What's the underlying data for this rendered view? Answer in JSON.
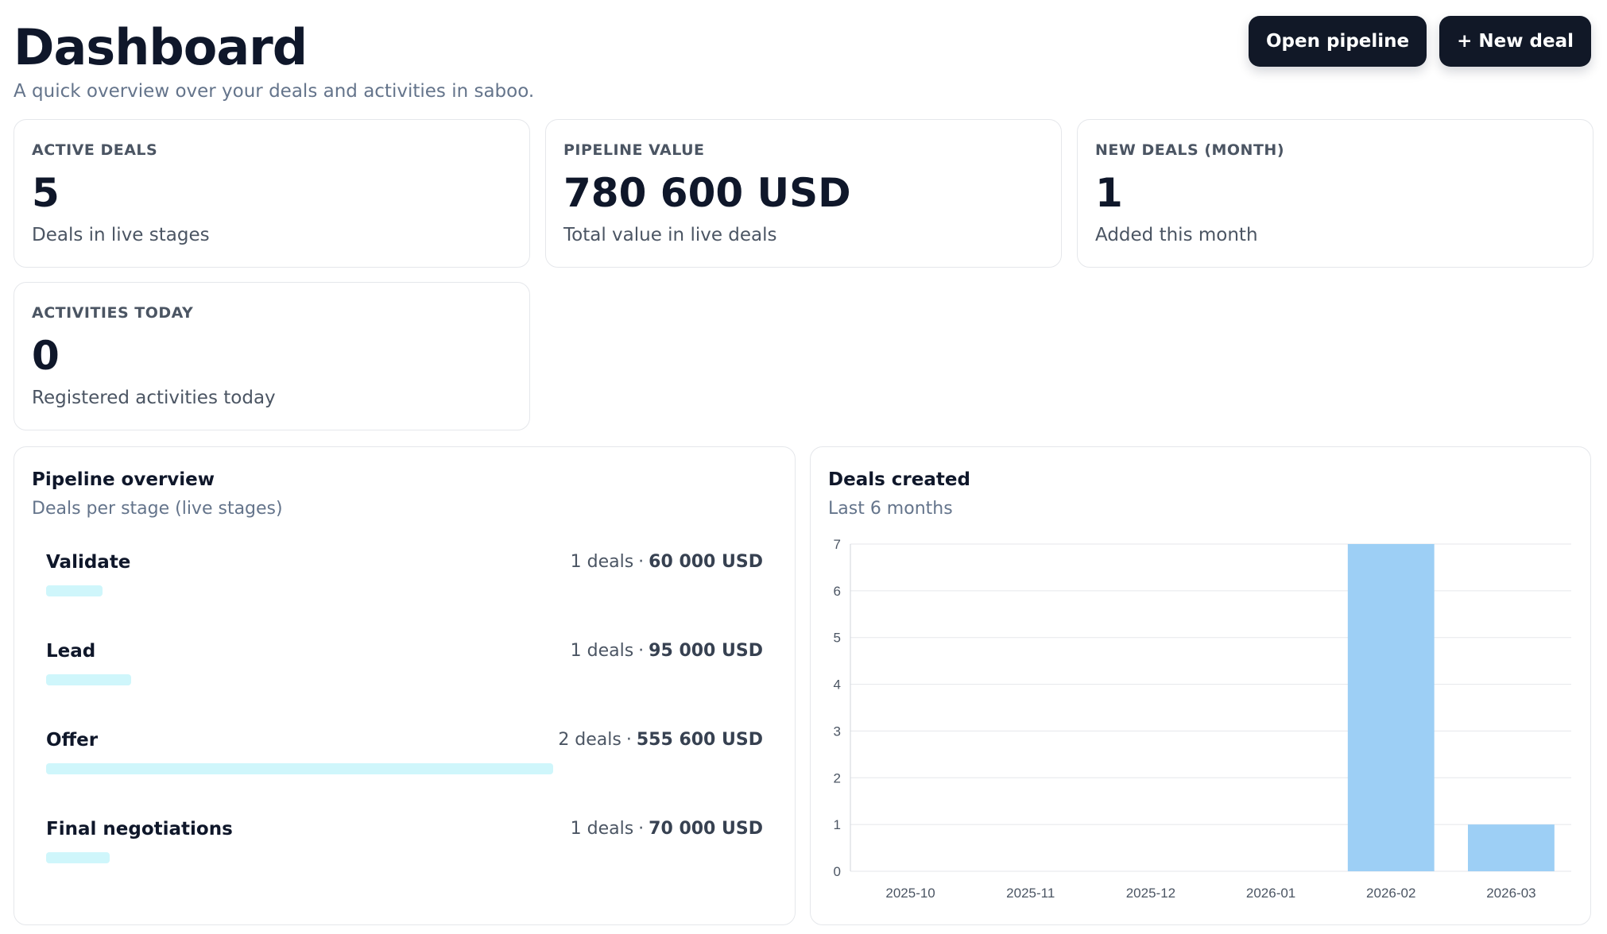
{
  "header": {
    "title": "Dashboard",
    "subtitle": "A quick overview over your deals and activities in saboo.",
    "open_pipeline_label": "Open pipeline",
    "new_deal_label": "+ New deal"
  },
  "kpis": [
    {
      "label": "ACTIVE DEALS",
      "value": "5",
      "sub": "Deals in live stages"
    },
    {
      "label": "PIPELINE VALUE",
      "value": "780 600 USD",
      "sub": "Total value in live deals"
    },
    {
      "label": "NEW DEALS (MONTH)",
      "value": "1",
      "sub": "Added this month"
    },
    {
      "label": "ACTIVITIES TODAY",
      "value": "0",
      "sub": "Registered activities today"
    }
  ],
  "pipeline": {
    "title": "Pipeline overview",
    "subtitle": "Deals per stage (live stages)",
    "stages": [
      {
        "name": "Validate",
        "deals": "1 deals",
        "separator": "·",
        "amount": "60 000 USD",
        "share": 0.112
      },
      {
        "name": "Lead",
        "deals": "1 deals",
        "separator": "·",
        "amount": "95 000 USD",
        "share": 0.168
      },
      {
        "name": "Offer",
        "deals": "2 deals",
        "separator": "·",
        "amount": "555 600 USD",
        "share": 1.0
      },
      {
        "name": "Final negotiations",
        "deals": "1 deals",
        "separator": "·",
        "amount": "70 000 USD",
        "share": 0.126
      }
    ]
  },
  "deals_chart": {
    "title": "Deals created",
    "subtitle": "Last 6 months"
  },
  "colors": {
    "bar_fill": "#9dcff5",
    "pipeline_bar": "#cff6fb",
    "button_bg": "#111827"
  },
  "chart_data": {
    "type": "bar",
    "categories": [
      "2025-10",
      "2025-11",
      "2025-12",
      "2026-01",
      "2026-02",
      "2026-03"
    ],
    "values": [
      0,
      0,
      0,
      0,
      7,
      1
    ],
    "title": "Deals created",
    "subtitle": "Last 6 months",
    "xlabel": "",
    "ylabel": "",
    "ylim": [
      0,
      7
    ],
    "yticks": [
      0,
      1,
      2,
      3,
      4,
      5,
      6,
      7
    ],
    "grid": true,
    "legend": "none"
  }
}
